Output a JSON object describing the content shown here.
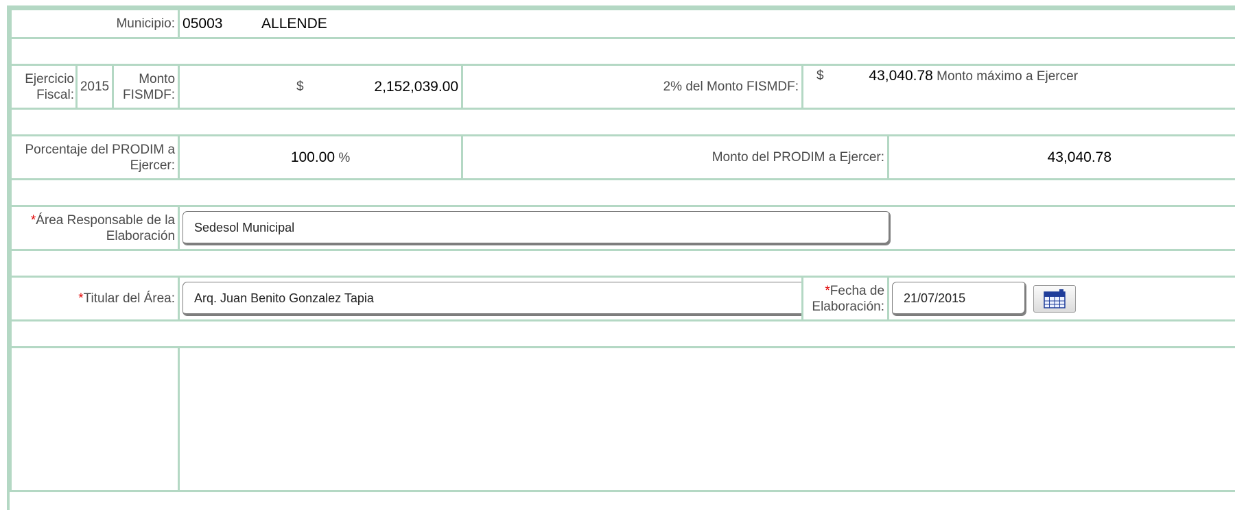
{
  "municipio": {
    "label": "Municipio:",
    "code": "05003",
    "name": "ALLENDE"
  },
  "ejercicio": {
    "label": "Ejercicio Fiscal:",
    "value": "2015"
  },
  "monto_fismdf": {
    "label": "Monto FISMDF:",
    "currency": "$",
    "value": "2,152,039.00"
  },
  "dos_por_ciento": {
    "label": "2% del Monto FISMDF:",
    "currency": "$",
    "value": "43,040.78",
    "note": "Monto máximo a Ejercer"
  },
  "prodim": {
    "pct_label": "Porcentaje del PRODIM a Ejercer:",
    "pct_value": "100.00",
    "pct_unit": "%",
    "monto_label": "Monto del PRODIM a Ejercer:",
    "monto_value": "43,040.78"
  },
  "area": {
    "required_mark": "*",
    "label": "Área Responsable de la Elaboración",
    "value": "Sedesol Municipal"
  },
  "titular": {
    "required_mark": "*",
    "label": "Titular del Área:",
    "value": "Arq. Juan Benito Gonzalez Tapia"
  },
  "fecha": {
    "required_mark": "*",
    "label": "Fecha de Elaboración:",
    "value": "21/07/2015",
    "button_icon": "calendar-icon"
  },
  "colors": {
    "border": "#b4d8c4",
    "required": "#e00000"
  }
}
